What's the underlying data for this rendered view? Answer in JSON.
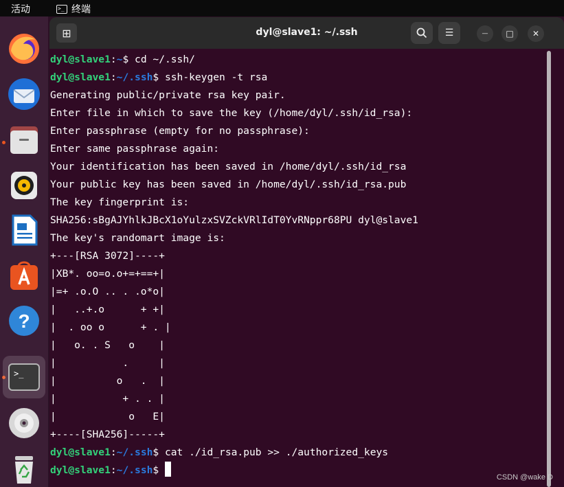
{
  "topbar": {
    "activities": "活动",
    "app_name": "终端"
  },
  "dock": {
    "items": [
      {
        "name": "firefox-icon"
      },
      {
        "name": "thunderbird-icon"
      },
      {
        "name": "files-icon"
      },
      {
        "name": "rhythmbox-icon"
      },
      {
        "name": "libreoffice-writer-icon"
      },
      {
        "name": "app-center-icon"
      },
      {
        "name": "help-icon"
      },
      {
        "name": "terminal-icon"
      },
      {
        "name": "disc-icon"
      },
      {
        "name": "trash-icon"
      }
    ],
    "help_glyph": "?",
    "terminal_glyph": ">_",
    "colors": {
      "dock_bg": "#3b1e35",
      "running_indicator": "#e95420"
    }
  },
  "window": {
    "title": "dyl@slave1: ~/.ssh",
    "new_tab_glyph": "⊞",
    "search_glyph": "🔍",
    "menu_glyph": "☰",
    "minimize_glyph": "—",
    "maximize_glyph": "□",
    "close_glyph": "✕"
  },
  "terminal": {
    "colors": {
      "background": "#300a24",
      "user": "#33d17a",
      "path": "#2a7bde",
      "text": "#ffffff"
    },
    "prompt_user": "dyl@slave1",
    "lines": [
      {
        "type": "prompt",
        "path": "~",
        "cmd": "cd ~/.ssh/"
      },
      {
        "type": "prompt",
        "path": "~/.ssh",
        "cmd": "ssh-keygen -t rsa"
      },
      {
        "type": "output",
        "text": "Generating public/private rsa key pair."
      },
      {
        "type": "output",
        "text": "Enter file in which to save the key (/home/dyl/.ssh/id_rsa):"
      },
      {
        "type": "output",
        "text": "Enter passphrase (empty for no passphrase):"
      },
      {
        "type": "output",
        "text": "Enter same passphrase again:"
      },
      {
        "type": "output",
        "text": "Your identification has been saved in /home/dyl/.ssh/id_rsa"
      },
      {
        "type": "output",
        "text": "Your public key has been saved in /home/dyl/.ssh/id_rsa.pub"
      },
      {
        "type": "output",
        "text": "The key fingerprint is:"
      },
      {
        "type": "output",
        "text": "SHA256:sBgAJYhlkJBcX1oYulzxSVZckVRlIdT0YvRNppr68PU dyl@slave1"
      },
      {
        "type": "output",
        "text": "The key's randomart image is:"
      },
      {
        "type": "output",
        "text": "+---[RSA 3072]----+"
      },
      {
        "type": "output",
        "text": "|XB*. oo=o.o+=+==+|"
      },
      {
        "type": "output",
        "text": "|=+ .o.O .. . .o*o|"
      },
      {
        "type": "output",
        "text": "|   ..+.o      + +|"
      },
      {
        "type": "output",
        "text": "|  . oo o      + . |"
      },
      {
        "type": "output",
        "text": "|   o. . S   o    |"
      },
      {
        "type": "output",
        "text": "|           .     |"
      },
      {
        "type": "output",
        "text": "|          o   .  |"
      },
      {
        "type": "output",
        "text": "|           + . . |"
      },
      {
        "type": "output",
        "text": "|            o   E|"
      },
      {
        "type": "output",
        "text": "+----[SHA256]-----+"
      },
      {
        "type": "prompt",
        "path": "~/.ssh",
        "cmd": "cat ./id_rsa.pub >> ./authorized_keys"
      },
      {
        "type": "prompt",
        "path": "~/.ssh",
        "cmd": "",
        "cursor": true
      }
    ]
  },
  "watermark": "CSDN @wake D"
}
